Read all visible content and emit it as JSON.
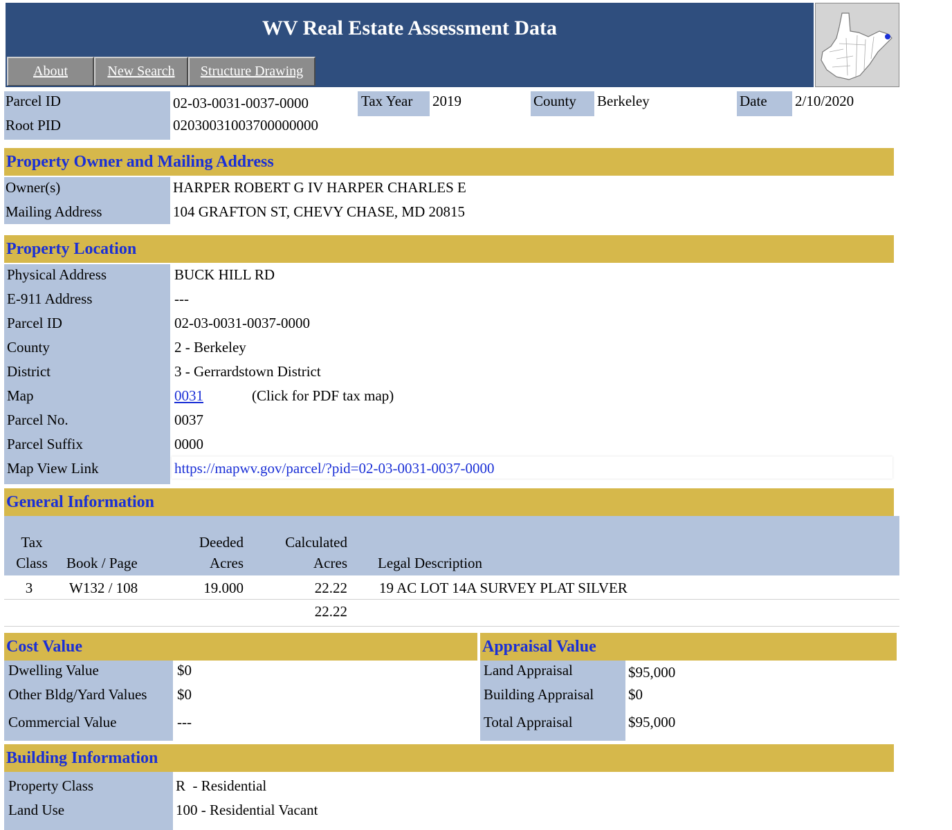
{
  "header": {
    "title": "WV Real Estate Assessment Data",
    "nav": [
      "About",
      "New Search",
      "Structure Drawing"
    ]
  },
  "summary": {
    "parcel_id_label": "Parcel ID",
    "parcel_id": "02-03-0031-0037-0000",
    "root_pid_label": "Root PID",
    "root_pid": "02030031003700000000",
    "tax_year_label": "Tax Year",
    "tax_year": "2019",
    "county_label": "County",
    "county": "Berkeley",
    "date_label": "Date",
    "date": "2/10/2020"
  },
  "owner": {
    "heading": "Property Owner and Mailing Address",
    "owners_label": "Owner(s)",
    "owners": "HARPER ROBERT G IV HARPER CHARLES E",
    "mailing_label": "Mailing Address",
    "mailing": "104 GRAFTON ST, CHEVY CHASE, MD 20815"
  },
  "location": {
    "heading": "Property Location",
    "rows": [
      {
        "label": "Physical Address",
        "value": "BUCK HILL RD"
      },
      {
        "label": "E-911 Address",
        "value": "---"
      },
      {
        "label": "Parcel ID",
        "value": "02-03-0031-0037-0000"
      },
      {
        "label": "County",
        "value": "2 - Berkeley"
      },
      {
        "label": "District",
        "value": "3 - Gerrardstown District"
      }
    ],
    "map_label": "Map",
    "map_link": "0031",
    "map_note": "(Click for PDF tax map)",
    "parcel_no_label": "Parcel No.",
    "parcel_no": "0037",
    "parcel_suffix_label": "Parcel Suffix",
    "parcel_suffix": "0000",
    "map_view_label": "Map View Link",
    "map_view_url": "https://mapwv.gov/parcel/?pid=02-03-0031-0037-0000"
  },
  "general": {
    "heading": "General Information",
    "columns": {
      "tax_class": [
        "Tax",
        "Class"
      ],
      "book_page": "Book / Page",
      "deeded": [
        "Deeded",
        "Acres"
      ],
      "calculated": [
        "Calculated",
        "Acres"
      ],
      "legal": "Legal Description"
    },
    "row": {
      "tax_class": "3",
      "book_page": "W132 / 108",
      "deeded": "19.000",
      "calculated": "22.22",
      "legal": "19 AC LOT 14A SURVEY PLAT SILVER"
    },
    "total_calculated": "22.22"
  },
  "cost": {
    "heading": "Cost Value",
    "rows": [
      {
        "label": "Dwelling Value",
        "value": "$0"
      },
      {
        "label": "Other Bldg/Yard Values",
        "value": "$0"
      },
      {
        "label": "Commercial Value",
        "value": "---"
      }
    ]
  },
  "appraisal": {
    "heading": "Appraisal Value",
    "rows": [
      {
        "label": "Land Appraisal",
        "value": "$95,000"
      },
      {
        "label": "Building Appraisal",
        "value": "$0"
      },
      {
        "label": "Total Appraisal",
        "value": "$95,000"
      }
    ]
  },
  "building": {
    "heading": "Building Information",
    "rows": [
      {
        "label": "Property Class",
        "value": "R  - Residential"
      },
      {
        "label": "Land Use",
        "value": "100 - Residential Vacant"
      }
    ]
  },
  "colors": {
    "banner": "#2f4e7e",
    "label_bg": "#b3c3dc",
    "section_bg": "#d6b84b",
    "section_text": "#1a2fd6"
  }
}
